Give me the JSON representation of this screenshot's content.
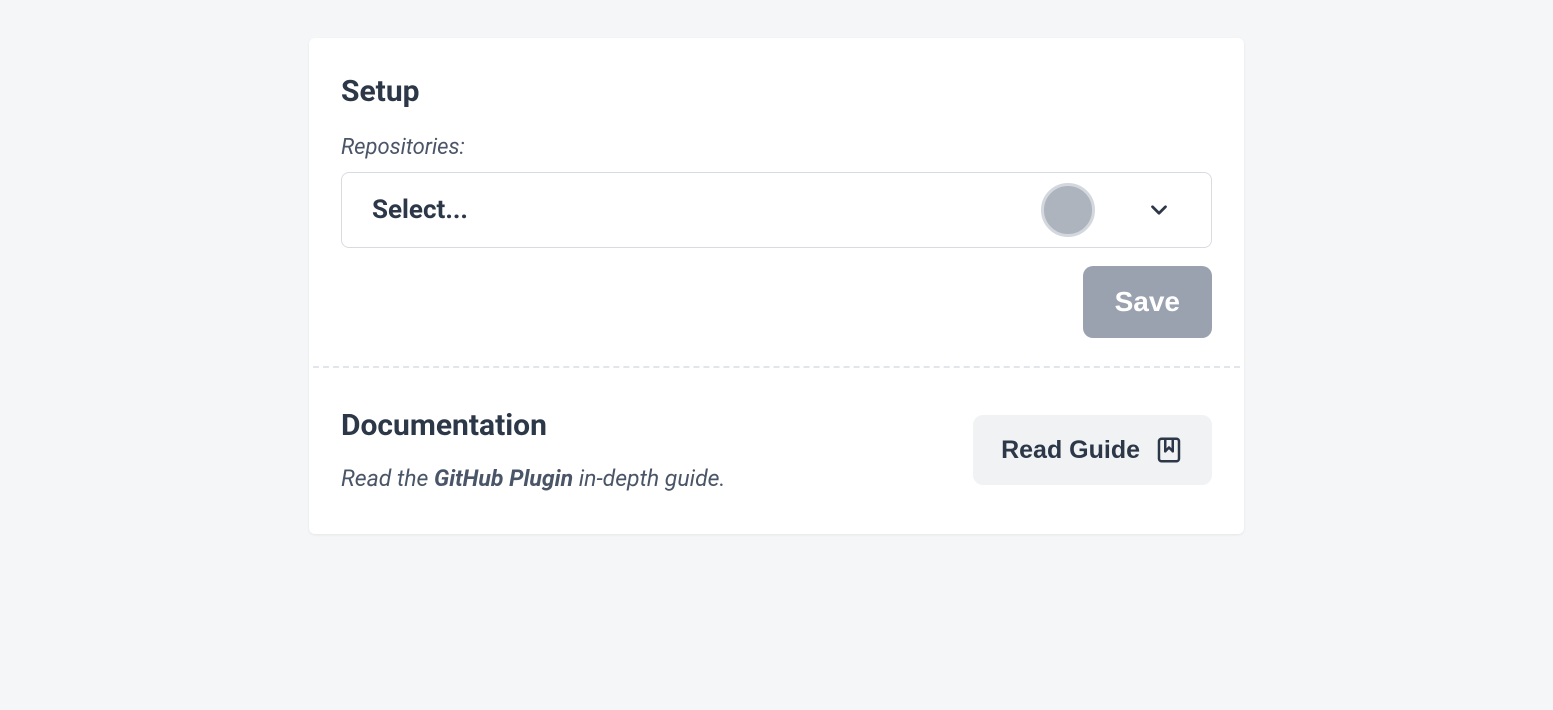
{
  "setup": {
    "title": "Setup",
    "repositories_label": "Repositories:",
    "select_placeholder": "Select...",
    "save_label": "Save"
  },
  "documentation": {
    "title": "Documentation",
    "text_prefix": "Read the ",
    "text_bold": "GitHub Plugin",
    "text_suffix": " in-depth guide.",
    "read_guide_label": "Read Guide"
  }
}
